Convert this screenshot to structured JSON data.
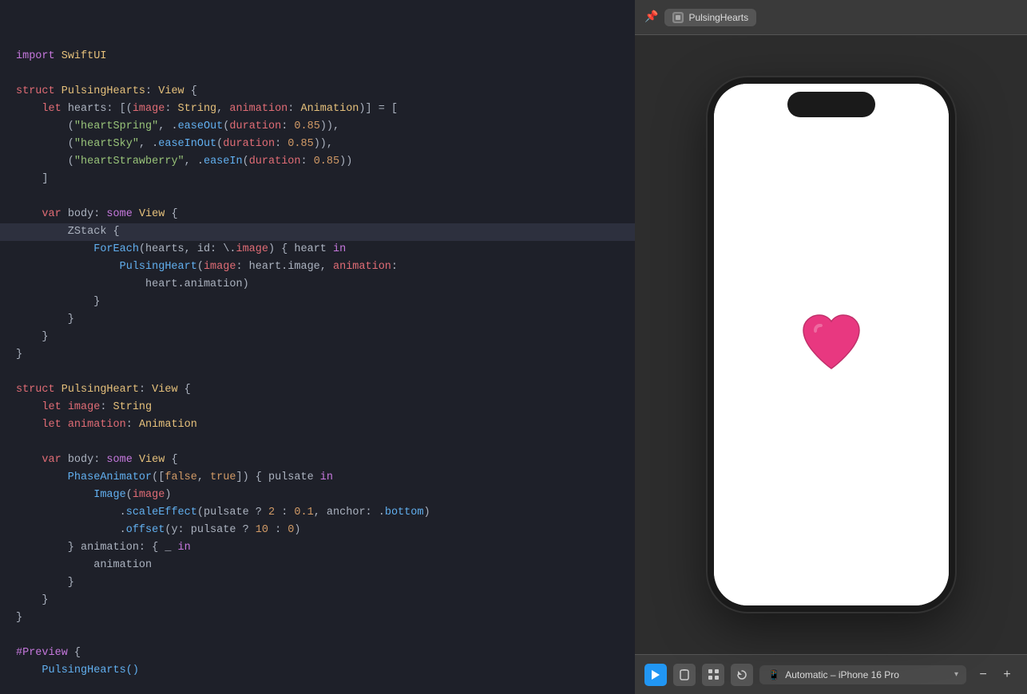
{
  "editor": {
    "lines": [
      {
        "id": 1,
        "tokens": [
          {
            "text": "import ",
            "class": "kw-import"
          },
          {
            "text": "SwiftUI",
            "class": "type-name"
          }
        ],
        "highlighted": false
      },
      {
        "id": 2,
        "tokens": [],
        "highlighted": false
      },
      {
        "id": 3,
        "tokens": [
          {
            "text": "struct ",
            "class": "kw-struct"
          },
          {
            "text": "PulsingHearts",
            "class": "struct-name"
          },
          {
            "text": ": ",
            "class": "plain"
          },
          {
            "text": "View",
            "class": "type-name"
          },
          {
            "text": " {",
            "class": "plain"
          }
        ],
        "highlighted": false
      },
      {
        "id": 4,
        "tokens": [
          {
            "text": "    let ",
            "class": "kw-let"
          },
          {
            "text": "hearts",
            "class": "identifier"
          },
          {
            "text": ": [(",
            "class": "plain"
          },
          {
            "text": "image",
            "class": "param"
          },
          {
            "text": ": ",
            "class": "plain"
          },
          {
            "text": "String",
            "class": "type-name"
          },
          {
            "text": ", ",
            "class": "plain"
          },
          {
            "text": "animation",
            "class": "param"
          },
          {
            "text": ": ",
            "class": "plain"
          },
          {
            "text": "Animation",
            "class": "type-name"
          },
          {
            "text": ")] = [",
            "class": "plain"
          }
        ],
        "highlighted": false
      },
      {
        "id": 5,
        "tokens": [
          {
            "text": "        (",
            "class": "plain"
          },
          {
            "text": "\"heartSpring\"",
            "class": "string"
          },
          {
            "text": ", .",
            "class": "plain"
          },
          {
            "text": "easeOut",
            "class": "method"
          },
          {
            "text": "(",
            "class": "plain"
          },
          {
            "text": "duration",
            "class": "param"
          },
          {
            "text": ": ",
            "class": "plain"
          },
          {
            "text": "0.85",
            "class": "number"
          },
          {
            "text": ")),",
            "class": "plain"
          }
        ],
        "highlighted": false
      },
      {
        "id": 6,
        "tokens": [
          {
            "text": "        (",
            "class": "plain"
          },
          {
            "text": "\"heartSky\"",
            "class": "string"
          },
          {
            "text": ", .",
            "class": "plain"
          },
          {
            "text": "easeInOut",
            "class": "method"
          },
          {
            "text": "(",
            "class": "plain"
          },
          {
            "text": "duration",
            "class": "param"
          },
          {
            "text": ": ",
            "class": "plain"
          },
          {
            "text": "0.85",
            "class": "number"
          },
          {
            "text": ")),",
            "class": "plain"
          }
        ],
        "highlighted": false
      },
      {
        "id": 7,
        "tokens": [
          {
            "text": "        (",
            "class": "plain"
          },
          {
            "text": "\"heartStrawberry\"",
            "class": "string"
          },
          {
            "text": ", .",
            "class": "plain"
          },
          {
            "text": "easeIn",
            "class": "method"
          },
          {
            "text": "(",
            "class": "plain"
          },
          {
            "text": "duration",
            "class": "param"
          },
          {
            "text": ": ",
            "class": "plain"
          },
          {
            "text": "0.85",
            "class": "number"
          },
          {
            "text": "))",
            "class": "plain"
          }
        ],
        "highlighted": false
      },
      {
        "id": 8,
        "tokens": [
          {
            "text": "    ]",
            "class": "plain"
          }
        ],
        "highlighted": false
      },
      {
        "id": 9,
        "tokens": [],
        "highlighted": false
      },
      {
        "id": 10,
        "tokens": [
          {
            "text": "    var ",
            "class": "kw-var"
          },
          {
            "text": "body",
            "class": "identifier"
          },
          {
            "text": ": ",
            "class": "plain"
          },
          {
            "text": "some ",
            "class": "kw-some"
          },
          {
            "text": "View",
            "class": "type-name"
          },
          {
            "text": " {",
            "class": "plain"
          }
        ],
        "highlighted": false
      },
      {
        "id": 11,
        "tokens": [
          {
            "text": "        ZStack {",
            "class": "plain"
          }
        ],
        "highlighted": true
      },
      {
        "id": 12,
        "tokens": [
          {
            "text": "            ForEach",
            "class": "func-call"
          },
          {
            "text": "(",
            "class": "plain"
          },
          {
            "text": "hearts",
            "class": "identifier"
          },
          {
            "text": ", id: \\.",
            "class": "plain"
          },
          {
            "text": "image",
            "class": "param"
          },
          {
            "text": ") { ",
            "class": "plain"
          },
          {
            "text": "heart",
            "class": "identifier"
          },
          {
            "text": " in",
            "class": "kw-in"
          }
        ],
        "highlighted": false
      },
      {
        "id": 13,
        "tokens": [
          {
            "text": "                PulsingHeart",
            "class": "func-call"
          },
          {
            "text": "(",
            "class": "plain"
          },
          {
            "text": "image",
            "class": "param"
          },
          {
            "text": ": heart.",
            "class": "plain"
          },
          {
            "text": "image",
            "class": "identifier"
          },
          {
            "text": ", ",
            "class": "plain"
          },
          {
            "text": "animation",
            "class": "param"
          },
          {
            "text": ":",
            "class": "plain"
          }
        ],
        "highlighted": false
      },
      {
        "id": 14,
        "tokens": [
          {
            "text": "                    heart.",
            "class": "plain"
          },
          {
            "text": "animation",
            "class": "identifier"
          },
          {
            "text": ")",
            "class": "plain"
          }
        ],
        "highlighted": false
      },
      {
        "id": 15,
        "tokens": [
          {
            "text": "            }",
            "class": "plain"
          }
        ],
        "highlighted": false
      },
      {
        "id": 16,
        "tokens": [
          {
            "text": "        }",
            "class": "plain"
          }
        ],
        "highlighted": false
      },
      {
        "id": 17,
        "tokens": [
          {
            "text": "    }",
            "class": "plain"
          }
        ],
        "highlighted": false
      },
      {
        "id": 18,
        "tokens": [
          {
            "text": "}",
            "class": "plain"
          }
        ],
        "highlighted": false
      },
      {
        "id": 19,
        "tokens": [],
        "highlighted": false
      },
      {
        "id": 20,
        "tokens": [
          {
            "text": "struct ",
            "class": "kw-struct"
          },
          {
            "text": "PulsingHeart",
            "class": "struct-name"
          },
          {
            "text": ": ",
            "class": "plain"
          },
          {
            "text": "View",
            "class": "type-name"
          },
          {
            "text": " {",
            "class": "plain"
          }
        ],
        "highlighted": false
      },
      {
        "id": 21,
        "tokens": [
          {
            "text": "    let ",
            "class": "kw-let"
          },
          {
            "text": "image",
            "class": "param"
          },
          {
            "text": ": ",
            "class": "plain"
          },
          {
            "text": "String",
            "class": "type-name"
          }
        ],
        "highlighted": false
      },
      {
        "id": 22,
        "tokens": [
          {
            "text": "    let ",
            "class": "kw-let"
          },
          {
            "text": "animation",
            "class": "param"
          },
          {
            "text": ": ",
            "class": "plain"
          },
          {
            "text": "Animation",
            "class": "type-name"
          }
        ],
        "highlighted": false
      },
      {
        "id": 23,
        "tokens": [],
        "highlighted": false
      },
      {
        "id": 24,
        "tokens": [
          {
            "text": "    var ",
            "class": "kw-var"
          },
          {
            "text": "body",
            "class": "identifier"
          },
          {
            "text": ": ",
            "class": "plain"
          },
          {
            "text": "some ",
            "class": "kw-some"
          },
          {
            "text": "View",
            "class": "type-name"
          },
          {
            "text": " {",
            "class": "plain"
          }
        ],
        "highlighted": false
      },
      {
        "id": 25,
        "tokens": [
          {
            "text": "        PhaseAnimator",
            "class": "func-call"
          },
          {
            "text": "([",
            "class": "plain"
          },
          {
            "text": "false",
            "class": "kw-false"
          },
          {
            "text": ", ",
            "class": "plain"
          },
          {
            "text": "true",
            "class": "kw-true"
          },
          {
            "text": "]) { ",
            "class": "plain"
          },
          {
            "text": "pulsate",
            "class": "identifier"
          },
          {
            "text": " in",
            "class": "kw-in"
          }
        ],
        "highlighted": false
      },
      {
        "id": 26,
        "tokens": [
          {
            "text": "            Image",
            "class": "func-call"
          },
          {
            "text": "(",
            "class": "plain"
          },
          {
            "text": "image",
            "class": "param"
          },
          {
            "text": ")",
            "class": "plain"
          }
        ],
        "highlighted": false
      },
      {
        "id": 27,
        "tokens": [
          {
            "text": "                .",
            "class": "plain"
          },
          {
            "text": "scaleEffect",
            "class": "method"
          },
          {
            "text": "(",
            "class": "plain"
          },
          {
            "text": "pulsate",
            "class": "identifier"
          },
          {
            "text": " ? ",
            "class": "plain"
          },
          {
            "text": "2",
            "class": "number"
          },
          {
            "text": " : ",
            "class": "plain"
          },
          {
            "text": "0.1",
            "class": "number"
          },
          {
            "text": ", anchor: .",
            "class": "plain"
          },
          {
            "text": "bottom",
            "class": "method"
          },
          {
            "text": ")",
            "class": "plain"
          }
        ],
        "highlighted": false
      },
      {
        "id": 28,
        "tokens": [
          {
            "text": "                .",
            "class": "plain"
          },
          {
            "text": "offset",
            "class": "method"
          },
          {
            "text": "(y: ",
            "class": "plain"
          },
          {
            "text": "pulsate",
            "class": "identifier"
          },
          {
            "text": " ? ",
            "class": "plain"
          },
          {
            "text": "10",
            "class": "number"
          },
          {
            "text": " : ",
            "class": "plain"
          },
          {
            "text": "0",
            "class": "number"
          },
          {
            "text": ")",
            "class": "plain"
          }
        ],
        "highlighted": false
      },
      {
        "id": 29,
        "tokens": [
          {
            "text": "        } animation: { ",
            "class": "plain"
          },
          {
            "text": "_",
            "class": "identifier"
          },
          {
            "text": " in",
            "class": "kw-in"
          }
        ],
        "highlighted": false
      },
      {
        "id": 30,
        "tokens": [
          {
            "text": "            animation",
            "class": "identifier"
          }
        ],
        "highlighted": false
      },
      {
        "id": 31,
        "tokens": [
          {
            "text": "        }",
            "class": "plain"
          }
        ],
        "highlighted": false
      },
      {
        "id": 32,
        "tokens": [
          {
            "text": "    }",
            "class": "plain"
          }
        ],
        "highlighted": false
      },
      {
        "id": 33,
        "tokens": [
          {
            "text": "}",
            "class": "plain"
          }
        ],
        "highlighted": false
      },
      {
        "id": 34,
        "tokens": [],
        "highlighted": false
      },
      {
        "id": 35,
        "tokens": [
          {
            "text": "#Preview",
            "class": "hash"
          },
          {
            "text": " {",
            "class": "plain"
          }
        ],
        "highlighted": false
      },
      {
        "id": 36,
        "tokens": [
          {
            "text": "    PulsingHearts()",
            "class": "func-call"
          }
        ],
        "highlighted": false
      }
    ]
  },
  "preview": {
    "tab_label": "PulsingHearts",
    "pin_icon": "📌",
    "device_label": "Automatic – iPhone 16 Pro",
    "toolbar_buttons": [
      "play",
      "device-frame",
      "grid",
      "rotate"
    ],
    "zoom_minus": "−",
    "zoom_plus": "+"
  }
}
